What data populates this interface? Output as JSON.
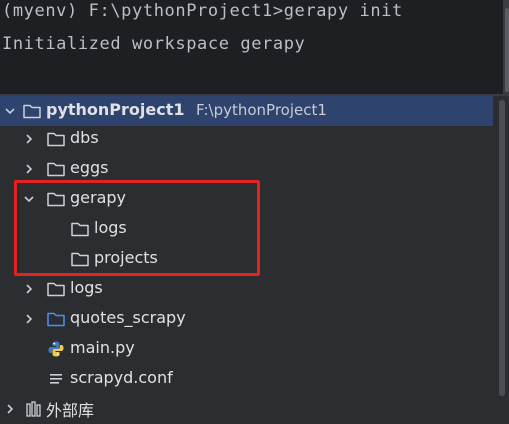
{
  "terminal": {
    "command_line": "(myenv) F:\\pythonProject1>gerapy init",
    "output_line": "Initialized workspace gerapy"
  },
  "tree": {
    "root": {
      "label": "pythonProject1",
      "path": "F:\\pythonProject1",
      "expanded": true,
      "selected": true
    },
    "items": [
      {
        "label": "dbs",
        "type": "folder",
        "expanded": false
      },
      {
        "label": "eggs",
        "type": "folder",
        "expanded": false
      },
      {
        "label": "gerapy",
        "type": "folder",
        "expanded": true
      },
      {
        "label": "logs",
        "type": "folder",
        "parent": "gerapy"
      },
      {
        "label": "projects",
        "type": "folder",
        "parent": "gerapy"
      },
      {
        "label": "logs",
        "type": "folder",
        "expanded": false
      },
      {
        "label": "quotes_scrapy",
        "type": "package-folder",
        "expanded": false
      },
      {
        "label": "main.py",
        "type": "python-file"
      },
      {
        "label": "scrapyd.conf",
        "type": "text-file"
      }
    ],
    "external_libraries": {
      "label": "外部库"
    }
  },
  "colors": {
    "terminal_bg": "#1e1f22",
    "panel_bg": "#2b2d30",
    "selection": "#2e436e",
    "highlight": "#e5221f",
    "package_folder": "#4d8ef7",
    "python_blue": "#3f7cc7",
    "python_yellow": "#f2c94c"
  }
}
